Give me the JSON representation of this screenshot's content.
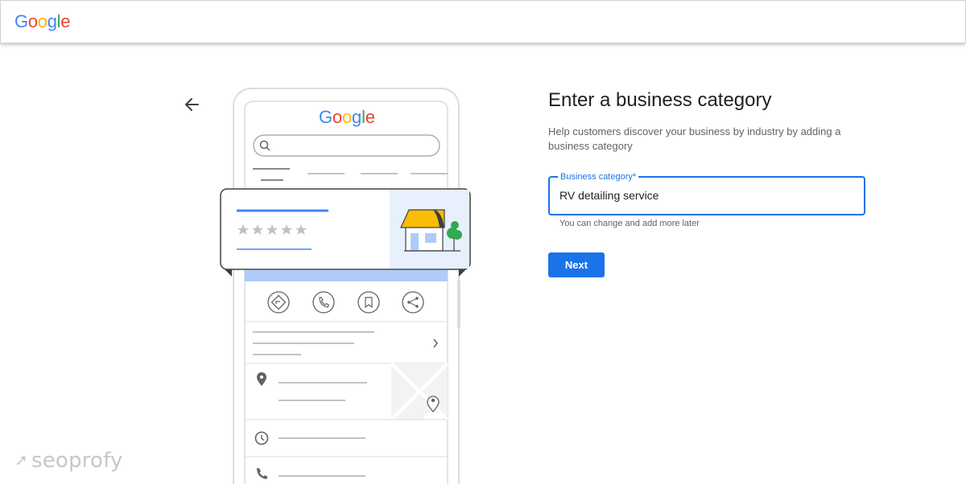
{
  "header": {
    "logo_letters": [
      "G",
      "o",
      "o",
      "g",
      "l",
      "e"
    ]
  },
  "illustration": {
    "logo_letters": [
      "G",
      "o",
      "o",
      "g",
      "l",
      "e"
    ]
  },
  "form": {
    "title": "Enter a business category",
    "description": "Help customers discover your business by industry by adding a business category",
    "field_label": "Business category*",
    "field_value": "RV detailing service",
    "helper_text": "You can change and add more later",
    "next_label": "Next"
  },
  "watermark": {
    "text": "seoprofy"
  },
  "colors": {
    "google_blue": "#4285F4",
    "google_red": "#EA4335",
    "google_yellow": "#FBBC05",
    "google_green": "#34A853",
    "accent": "#1a73e8"
  },
  "icons": [
    "back-arrow-icon",
    "search-icon",
    "directions-icon",
    "phone-icon",
    "bookmark-icon",
    "share-icon",
    "chevron-right-icon",
    "location-pin-icon",
    "clock-icon",
    "store-icon",
    "star-icon"
  ]
}
